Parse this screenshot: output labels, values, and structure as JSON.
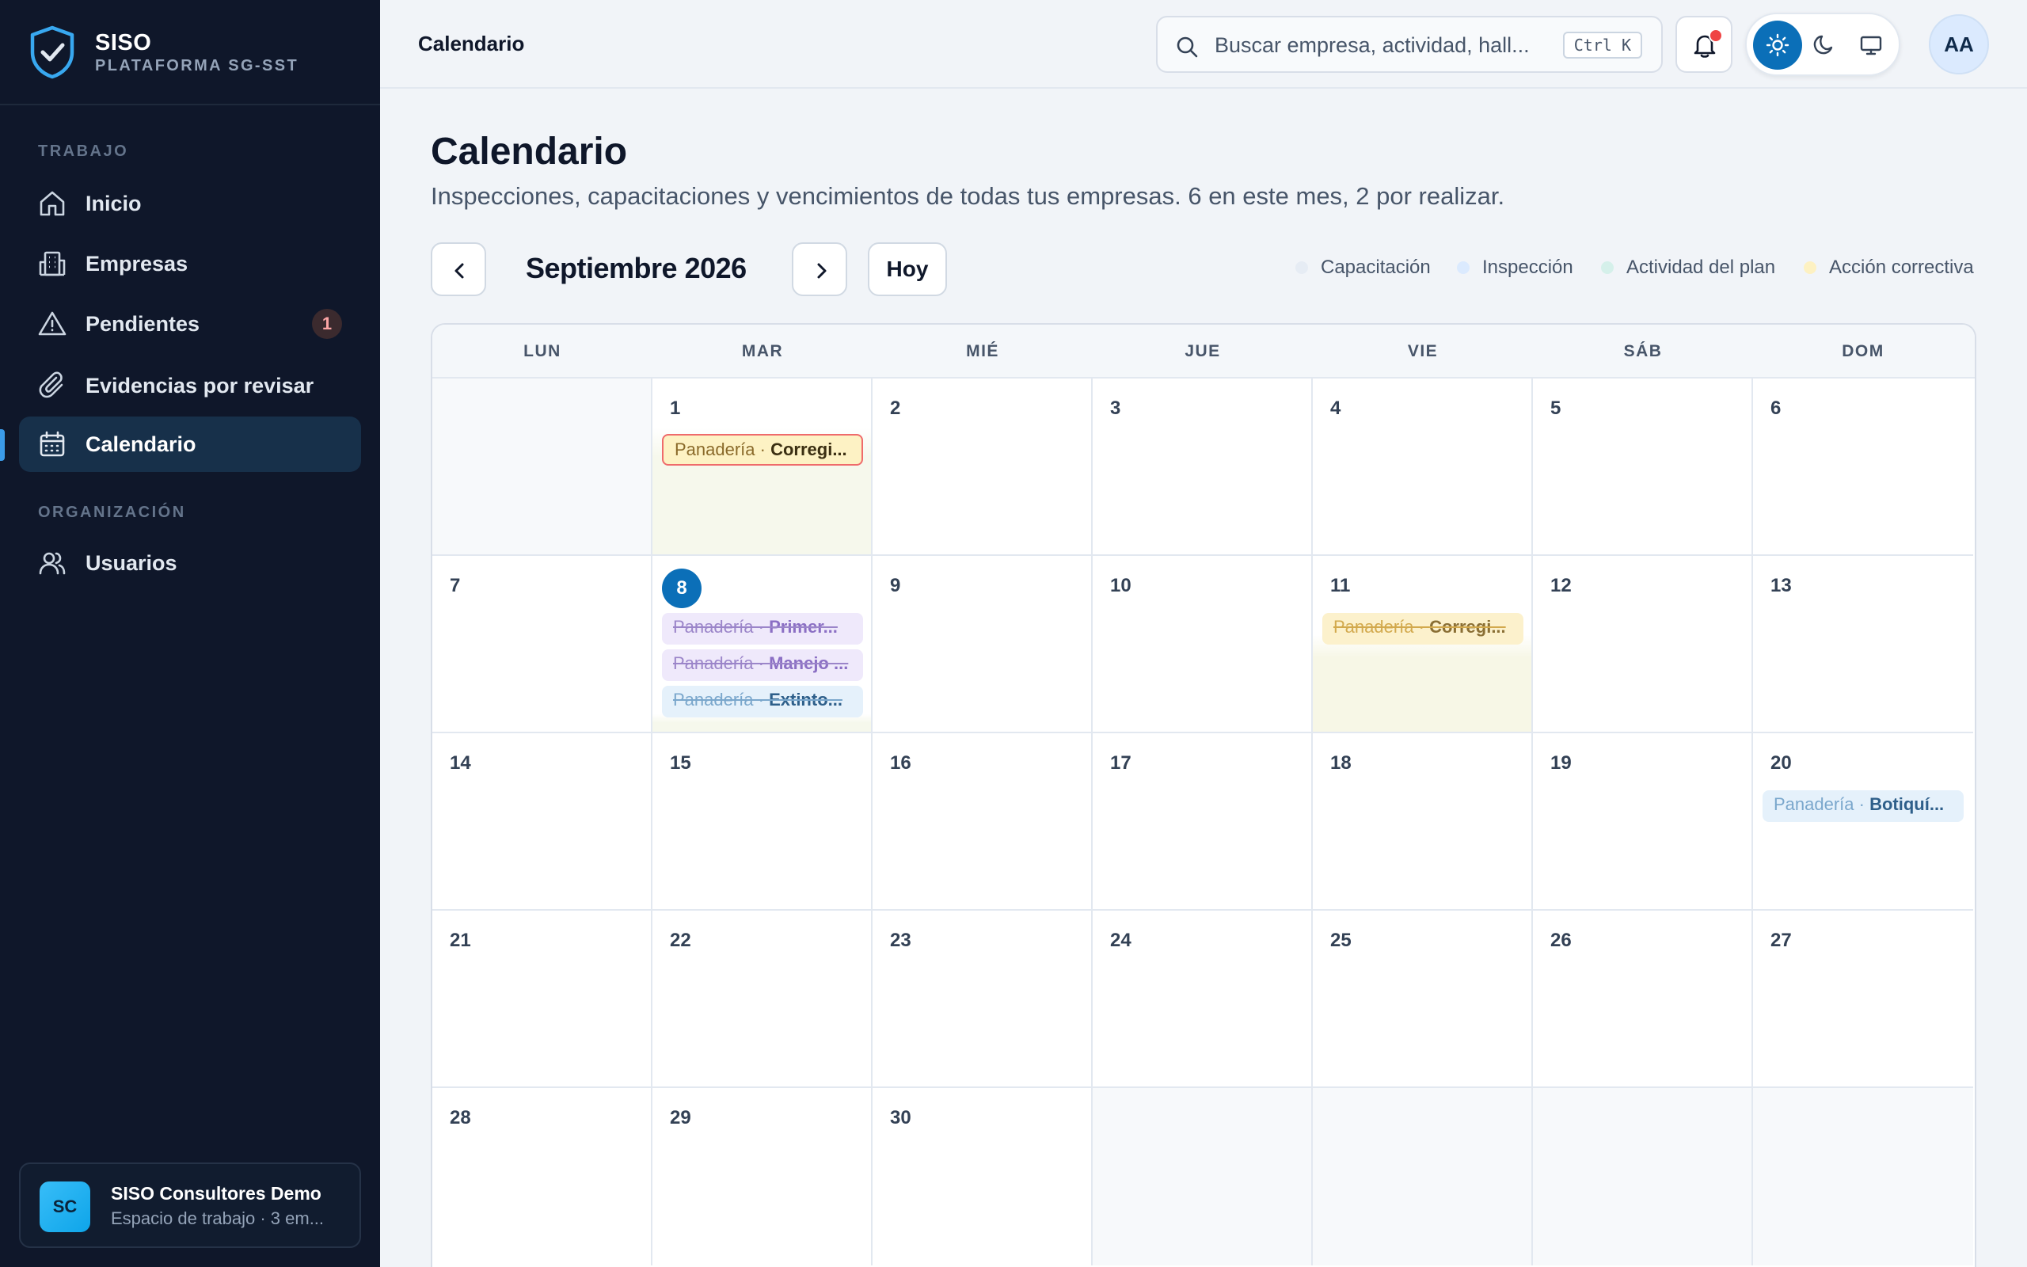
{
  "brand": {
    "title": "SISO",
    "subtitle": "PLATAFORMA SG-SST"
  },
  "sidebar": {
    "sections": [
      {
        "label": "TRABAJO"
      },
      {
        "label": "ORGANIZACIÓN"
      }
    ],
    "items": [
      {
        "label": "Inicio",
        "icon": "home-icon"
      },
      {
        "label": "Empresas",
        "icon": "building-icon"
      },
      {
        "label": "Pendientes",
        "icon": "warning-icon",
        "badge": "1"
      },
      {
        "label": "Evidencias por revisar",
        "icon": "paperclip-icon"
      },
      {
        "label": "Calendario",
        "icon": "calendar-icon",
        "active": true
      },
      {
        "label": "Usuarios",
        "icon": "users-icon"
      }
    ],
    "workspace": {
      "initials": "SC",
      "title": "SISO Consultores Demo",
      "subtitle": "Espacio de trabajo · 3 em..."
    }
  },
  "topbar": {
    "breadcrumb": "Calendario",
    "search_placeholder": "Buscar empresa, actividad, hall...",
    "shortcut": "Ctrl K",
    "avatar": "AA"
  },
  "page": {
    "title": "Calendario",
    "subtitle": "Inspecciones, capacitaciones y vencimientos de todas tus empresas. 6 en este mes, 2 por realizar.",
    "month": "Septiembre 2026",
    "today_label": "Hoy"
  },
  "legend": [
    {
      "label": "Capacitación",
      "color": "#e6ecf4"
    },
    {
      "label": "Inspección",
      "color": "#dbeafe"
    },
    {
      "label": "Actividad del plan",
      "color": "#d5f0ea"
    },
    {
      "label": "Acción correctiva",
      "color": "#fdf1c2"
    }
  ],
  "calendar": {
    "weekdays": [
      "LUN",
      "MAR",
      "MIÉ",
      "JUE",
      "VIE",
      "SÁB",
      "DOM"
    ],
    "days": [
      "",
      "1",
      "2",
      "3",
      "4",
      "5",
      "6",
      "7",
      "8",
      "9",
      "10",
      "11",
      "12",
      "13",
      "14",
      "15",
      "16",
      "17",
      "18",
      "19",
      "20",
      "21",
      "22",
      "23",
      "24",
      "25",
      "26",
      "27",
      "28",
      "29",
      "30",
      "",
      "",
      "",
      ""
    ],
    "events": {
      "sep1": {
        "company": "Panadería · ",
        "title": "Corregi..."
      },
      "sep8a": {
        "company": "Panadería · ",
        "title": "Primer..."
      },
      "sep8b": {
        "company": "Panadería · ",
        "title": "Manejo ..."
      },
      "sep8c": {
        "company": "Panadería · ",
        "title": "Extinto..."
      },
      "sep11": {
        "company": "Panadería · ",
        "title": "Corregi..."
      },
      "sep20": {
        "company": "Panadería · ",
        "title": "Botiquí..."
      }
    }
  }
}
